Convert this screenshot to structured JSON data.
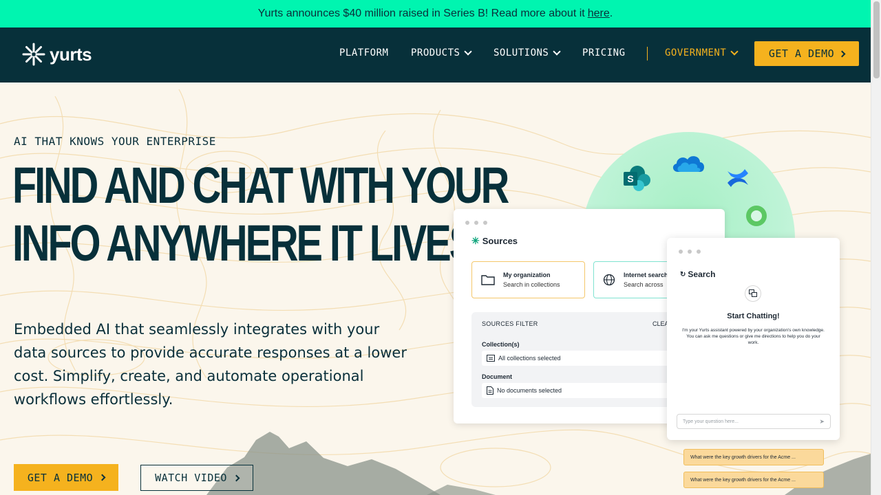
{
  "announcement": {
    "text": "Yurts announces $40 million raised in Series B! Read more about it",
    "link": "here",
    "end": "."
  },
  "nav": {
    "logo": "yurts",
    "items": [
      {
        "label": "PLATFORM",
        "dropdown": false
      },
      {
        "label": "PRODUCTS",
        "dropdown": true
      },
      {
        "label": "SOLUTIONS",
        "dropdown": true
      },
      {
        "label": "PRICING",
        "dropdown": false
      }
    ],
    "government": "GOVERNMENT",
    "cta": "GET A DEMO"
  },
  "hero": {
    "eyebrow": "AI THAT KNOWS YOUR ENTERPRISE",
    "headline_line1": "FIND AND CHAT WITH YOUR",
    "headline_line2": "INFO ANYWHERE IT LIVES",
    "subtext": "Embedded AI that seamlessly integrates with your data sources to provide accurate responses at a lower cost. Simplify, create, and automate operational workflows effortlessly.",
    "primary_cta": "GET A DEMO",
    "secondary_cta": "WATCH VIDEO"
  },
  "sources_card": {
    "title": "Sources",
    "options": [
      {
        "title": "My organization",
        "subtitle": "Search in collections"
      },
      {
        "title": "Internet search",
        "subtitle": "Search across"
      }
    ],
    "filter": {
      "heading": "SOURCES FILTER",
      "clear": "CLEAR",
      "collection_label": "Collection(s)",
      "collection_value": "All collections selected",
      "document_label": "Document",
      "document_value": "No documents selected"
    }
  },
  "chat_card": {
    "title": "Search",
    "heading": "Start Chatting!",
    "description": "I'm your Yurts assistant powered by your organization's own knowledge. You can ask me questions or give me directions to help you do your work.",
    "suggestions": [
      "What were the key growth drivers for the Acme ...",
      "What were the key growth drivers for the Acme ..."
    ],
    "input_placeholder": "Type your question here..."
  },
  "icons": [
    "sharepoint-icon",
    "onedrive-icon",
    "confluence-icon",
    "green-ring-icon"
  ],
  "colors": {
    "announcement_bg": "#00f5b0",
    "nav_bg": "#07303a",
    "accent": "#f5b21e",
    "page_bg": "#fbf6ec"
  }
}
